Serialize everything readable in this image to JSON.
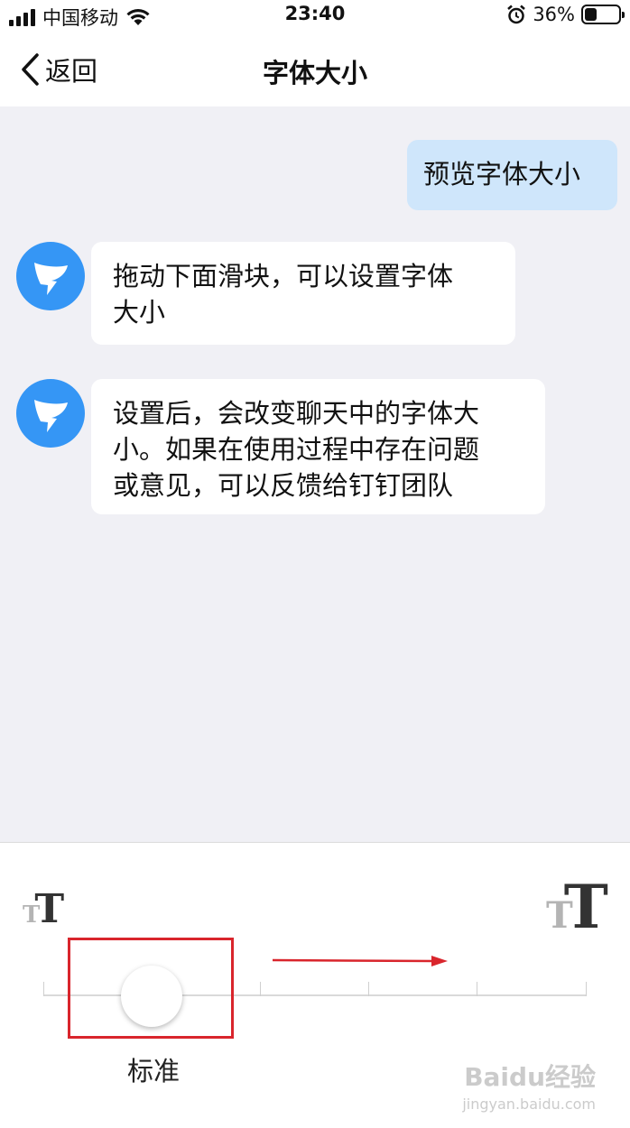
{
  "status_bar": {
    "carrier": "中国移动",
    "time": "23:40",
    "battery": "36%",
    "battery_level": 0.36,
    "icons": [
      "signal-icon",
      "wifi-icon",
      "alarm-icon",
      "battery-icon"
    ]
  },
  "nav": {
    "back_label": "返回",
    "title": "字体大小"
  },
  "chat": {
    "self_message": "预览字体大小",
    "bot_messages": [
      {
        "lines": [
          "拖动下面滑块，可以设置字体",
          "大小"
        ]
      },
      {
        "lines": [
          "设置后，会改变聊天中的字体大",
          "小。如果在使用过程中存在问题",
          "或意见，可以反馈给钉钉团队"
        ]
      }
    ]
  },
  "font_slider": {
    "small_icon": "small-text-size-icon",
    "large_icon": "large-text-size-icon",
    "steps": 6,
    "selected_step": 1,
    "selected_label": "标准"
  },
  "annotations": {
    "box_color": "#d9252c",
    "arrow_color": "#d9252c"
  },
  "watermark": {
    "text": "Baidu经验",
    "sub": "jingyan.baidu.com"
  },
  "colors": {
    "chat_bg": "#f0f0f5",
    "self_bubble": "#cfe6fb",
    "avatar_blue": "#3596f5"
  }
}
